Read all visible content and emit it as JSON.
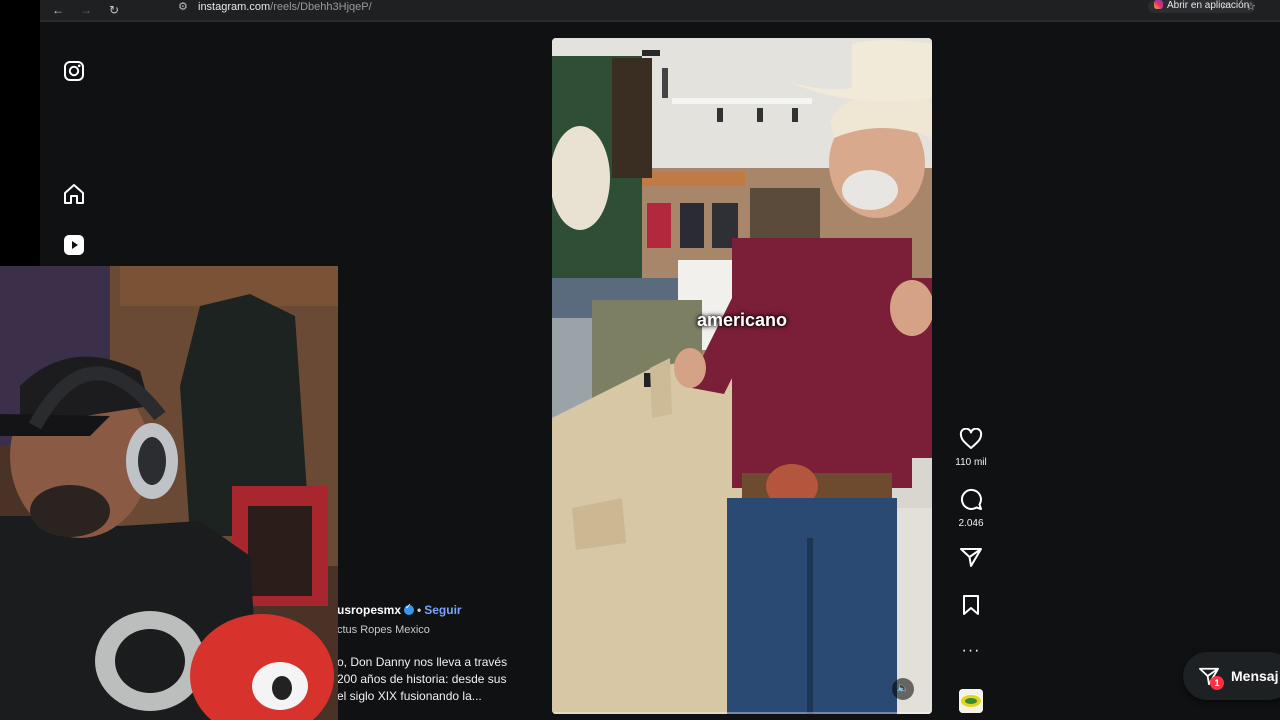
{
  "browser": {
    "url_host": "instagram.com",
    "url_path": "/reels/Dbehh3HjqeP/",
    "open_app_label": "Abrir en aplicación"
  },
  "reel": {
    "overlay_word": "americano",
    "likes": "110 mil",
    "comments": "2.046"
  },
  "post": {
    "author": "usropesmx",
    "follow_label": "Seguir",
    "subtitle": "ctus Ropes Mexico",
    "description_lines": [
      "o, Don Danny nos lleva a través",
      "200 años de historia: desde sus",
      " el siglo XIX fusionando la..."
    ]
  },
  "messages": {
    "label": "Mensaj",
    "badge": "1"
  },
  "colors": {
    "page_bg": "#0f1113",
    "accent_link": "#74a6ff",
    "badge_red": "#ff3040",
    "verified_blue": "#3897f0"
  },
  "icons": [
    "back-arrow-icon",
    "forward-arrow-icon",
    "reload-icon",
    "site-settings-icon",
    "zoom-icon",
    "star-icon",
    "instagram-icon",
    "home-icon",
    "reels-icon",
    "heart-icon",
    "comment-icon",
    "share-icon",
    "bookmark-icon",
    "more-icon",
    "mute-icon",
    "messages-icon"
  ]
}
